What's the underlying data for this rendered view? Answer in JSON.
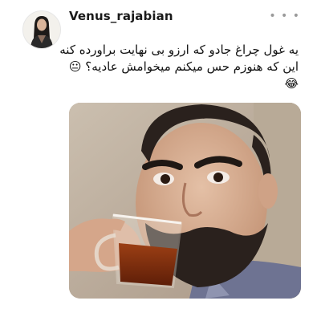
{
  "tweet": {
    "username": "Venus_rajabian",
    "line1": "یه غول چراغ جادو که ارزو بی نهایت براورده کنه",
    "line2": "این که هنوزم حس میکنم میخوامش عادیه؟",
    "line2_emoji": "😐",
    "line3_emoji": "😂",
    "more_icon": "more-horizontal-icon",
    "avatar_icon": "profile-avatar",
    "media_description_icon": "photo"
  }
}
